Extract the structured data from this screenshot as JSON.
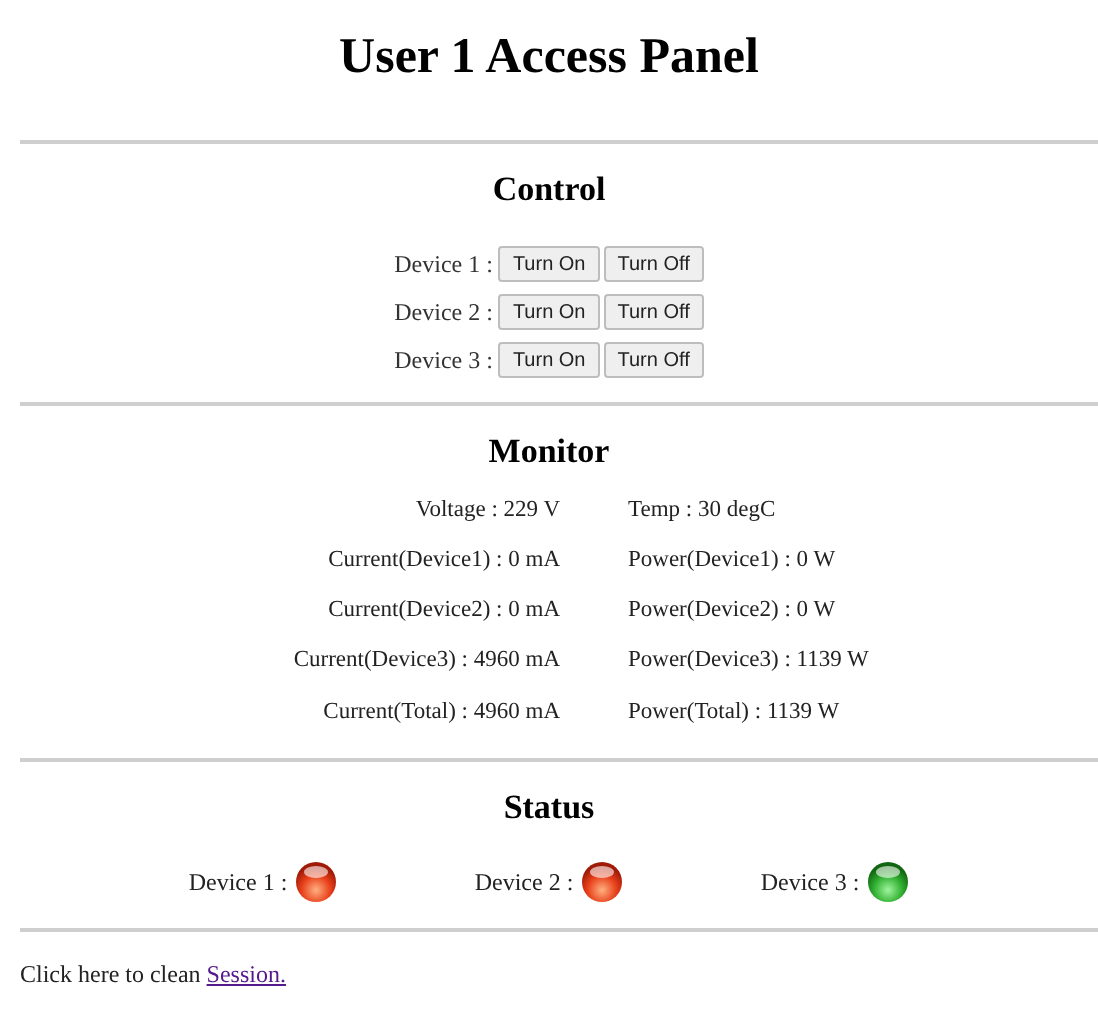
{
  "title": "User 1 Access Panel",
  "control": {
    "heading": "Control",
    "devices": [
      {
        "label": "Device 1 :",
        "buttons": [
          "Turn On",
          "Turn Off"
        ]
      },
      {
        "label": "Device 2 :",
        "buttons": [
          "Turn On",
          "Turn Off"
        ]
      },
      {
        "label": "Device 3 :",
        "buttons": [
          "Turn On",
          "Turn Off"
        ]
      }
    ]
  },
  "monitor": {
    "heading": "Monitor",
    "rows": [
      [
        "Voltage : 229 V",
        "Temp : 30 degC"
      ],
      [
        "Current(Device1) : 0 mA",
        "Power(Device1) : 0 W"
      ],
      [
        "Current(Device2) : 0 mA",
        "Power(Device2) : 0 W"
      ],
      [
        "Current(Device3) : 4960 mA",
        "Power(Device3) : 1139 W"
      ],
      [
        "Current(Total) : 4960 mA",
        "Power(Total) : 1139 W"
      ]
    ]
  },
  "status": {
    "heading": "Status",
    "devices": [
      {
        "label": "Device 1 :",
        "on": false
      },
      {
        "label": "Device 2 :",
        "on": false
      },
      {
        "label": "Device 3 :",
        "on": true
      }
    ]
  },
  "footer": {
    "text": "Click here to clean ",
    "link": "Session."
  }
}
